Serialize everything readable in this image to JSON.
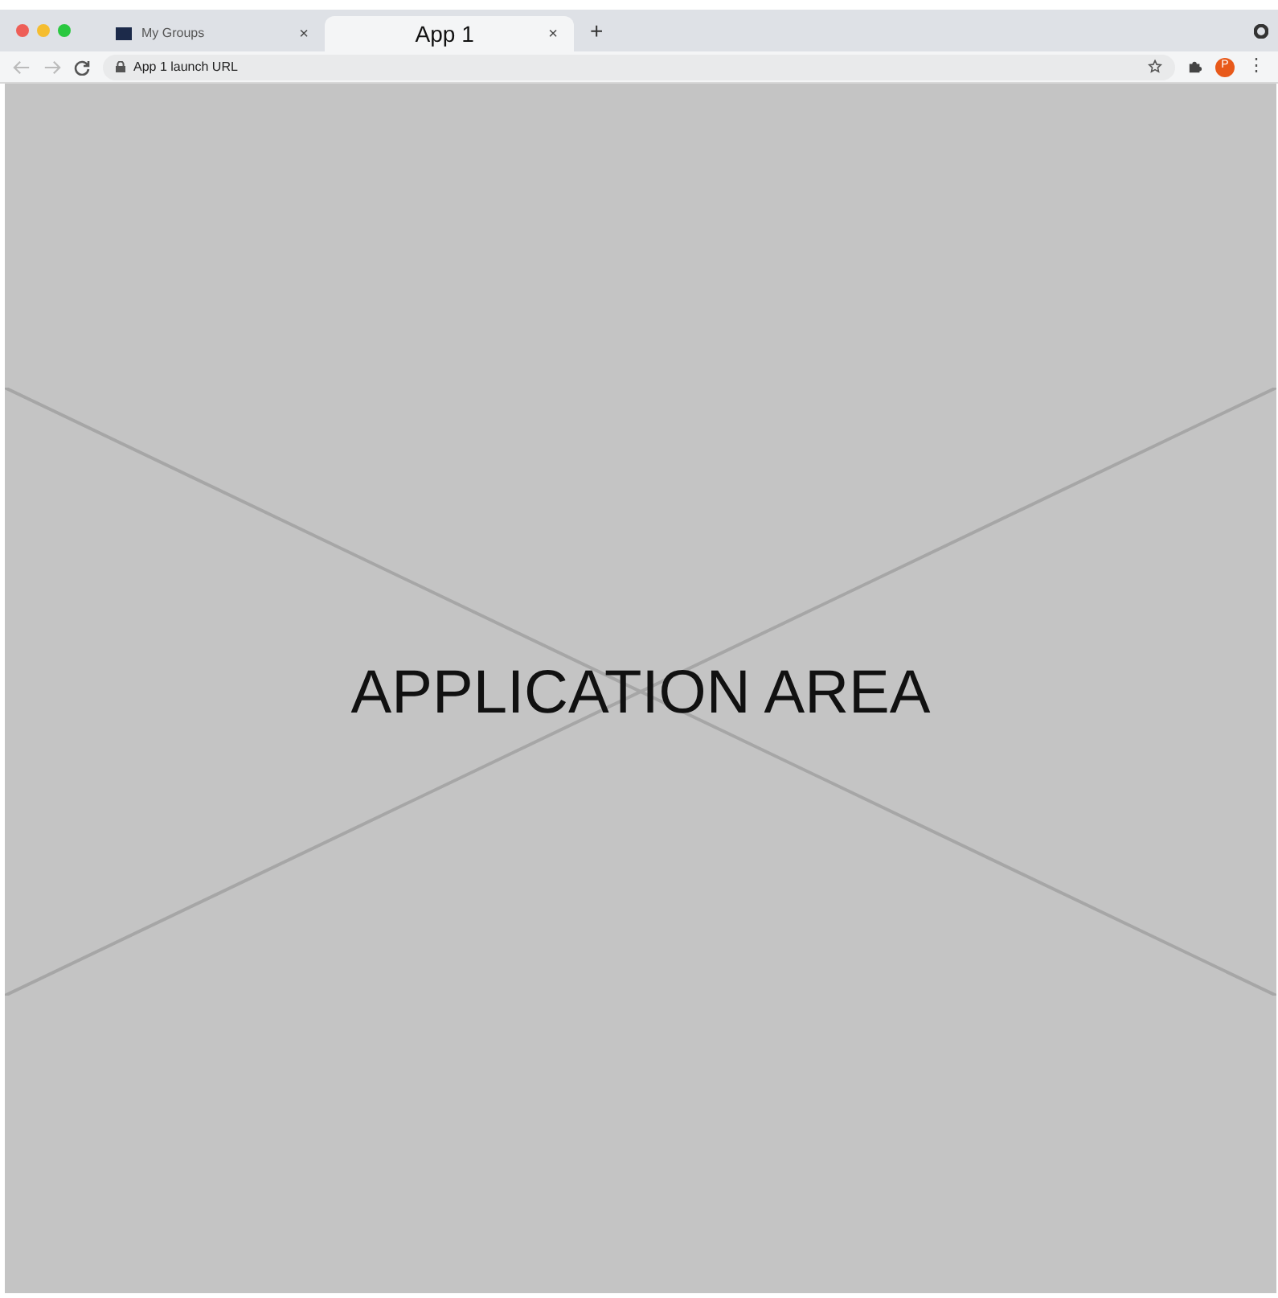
{
  "tabs": [
    {
      "title": "My Groups",
      "close": "×",
      "selected": false
    },
    {
      "title": "App 1",
      "close": "×",
      "selected": true
    }
  ],
  "new_tab": "+",
  "address_bar": {
    "url": "App 1 launch URL"
  },
  "profile": {
    "initial": "P"
  },
  "menu": "⋮",
  "app_area": {
    "label": "APPLICATION AREA"
  }
}
